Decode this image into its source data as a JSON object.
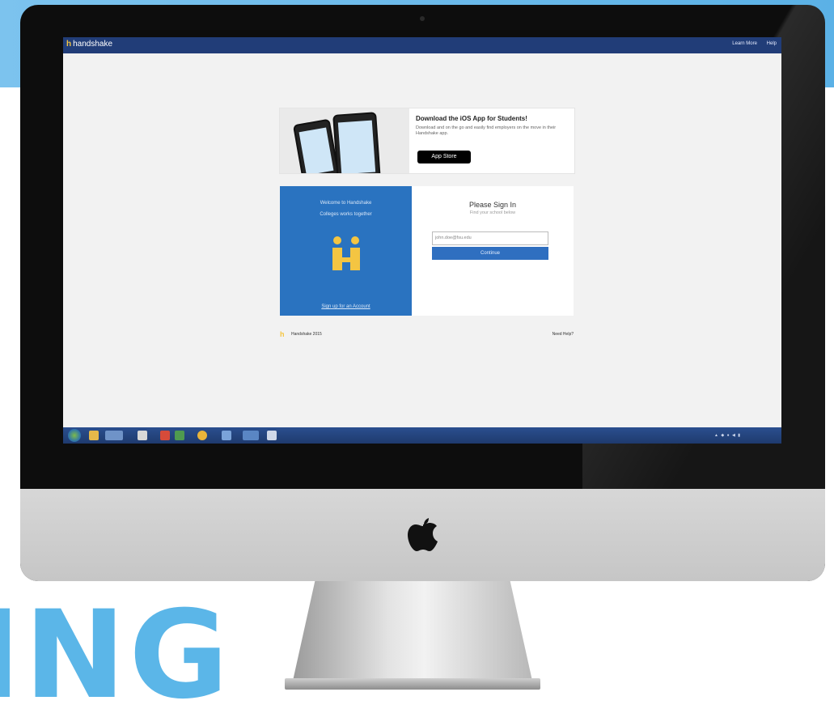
{
  "site": {
    "brand_name": "handshake",
    "nav": [
      "Learn More",
      "Help"
    ]
  },
  "promo": {
    "title": "Download the iOS App for Students!",
    "description": "Download and on the go and easily find employers on the move in their Handshake app.",
    "appstore_label": "App Store"
  },
  "welcome": {
    "line1": "Welcome to Handshake",
    "line2": "Colleges works together",
    "signup_link": "Sign up for an Account"
  },
  "signin": {
    "title": "Please Sign In",
    "subtitle": "Find your school below",
    "email_placeholder": "john.doe@fsu.edu",
    "continue_label": "Continue"
  },
  "footer": {
    "left_text": "Handshake 2015",
    "right_text": "Need Help?"
  },
  "overlay": {
    "big_text": "ING"
  },
  "colors": {
    "topnav": "#213d78",
    "welcome_panel": "#2a73c0",
    "primary_button": "#2f6fc0",
    "brand_yellow": "#f4c542",
    "banner": "#5bb1e6"
  },
  "icons": [
    "handshake-logo-icon",
    "apple-logo-icon",
    "windows-start-icon",
    "app-store-icon"
  ]
}
